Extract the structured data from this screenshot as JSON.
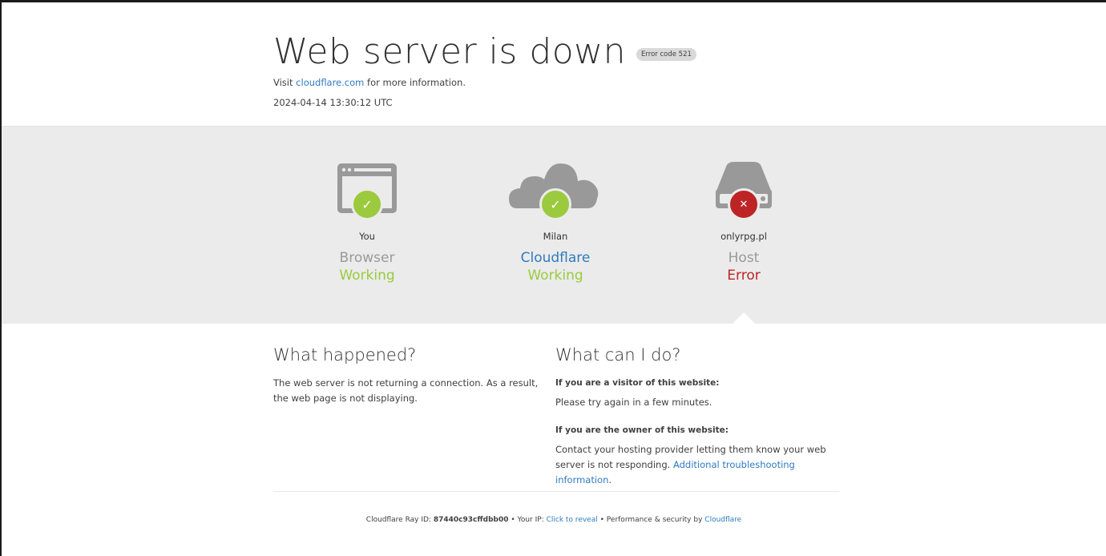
{
  "header": {
    "title": "Web server is down",
    "error_badge": "Error code 521",
    "visit_prefix": "Visit",
    "visit_link": "cloudflare.com",
    "visit_suffix": "for more information.",
    "timestamp": "2024-04-14 13:30:12 UTC"
  },
  "diagram": {
    "nodes": [
      {
        "location": "You",
        "kind": "Browser",
        "status": "Working",
        "icon": "browser-icon",
        "ok": true
      },
      {
        "location": "Milan",
        "kind": "Cloudflare",
        "status": "Working",
        "icon": "cloud-icon",
        "ok": true
      },
      {
        "location": "onlyrpg.pl",
        "kind": "Host",
        "status": "Error",
        "icon": "server-icon",
        "ok": false
      }
    ],
    "colors": {
      "ok": "#9bca3e",
      "error": "#bd2426",
      "link": "#2f7bbf",
      "icon_gray": "#999999"
    }
  },
  "what_happened": {
    "heading": "What happened?",
    "text": "The web server is not returning a connection. As a result, the web page is not displaying."
  },
  "what_can_i_do": {
    "heading": "What can I do?",
    "visitor_q": "If you are a visitor of this website:",
    "visitor_a": "Please try again in a few minutes.",
    "owner_q": "If you are the owner of this website:",
    "owner_a": "Contact your hosting provider letting them know your web server is not responding.",
    "owner_link": "Additional troubleshooting information",
    "owner_end": "."
  },
  "footer": {
    "ray_label": "Cloudflare Ray ID:",
    "ray_id": "87440c93cffdbb00",
    "sep1": "•",
    "ip_label": "Your IP:",
    "ip_link": "Click to reveal",
    "sep2": "•",
    "perf_label": "Performance & security by",
    "perf_link": "Cloudflare"
  }
}
